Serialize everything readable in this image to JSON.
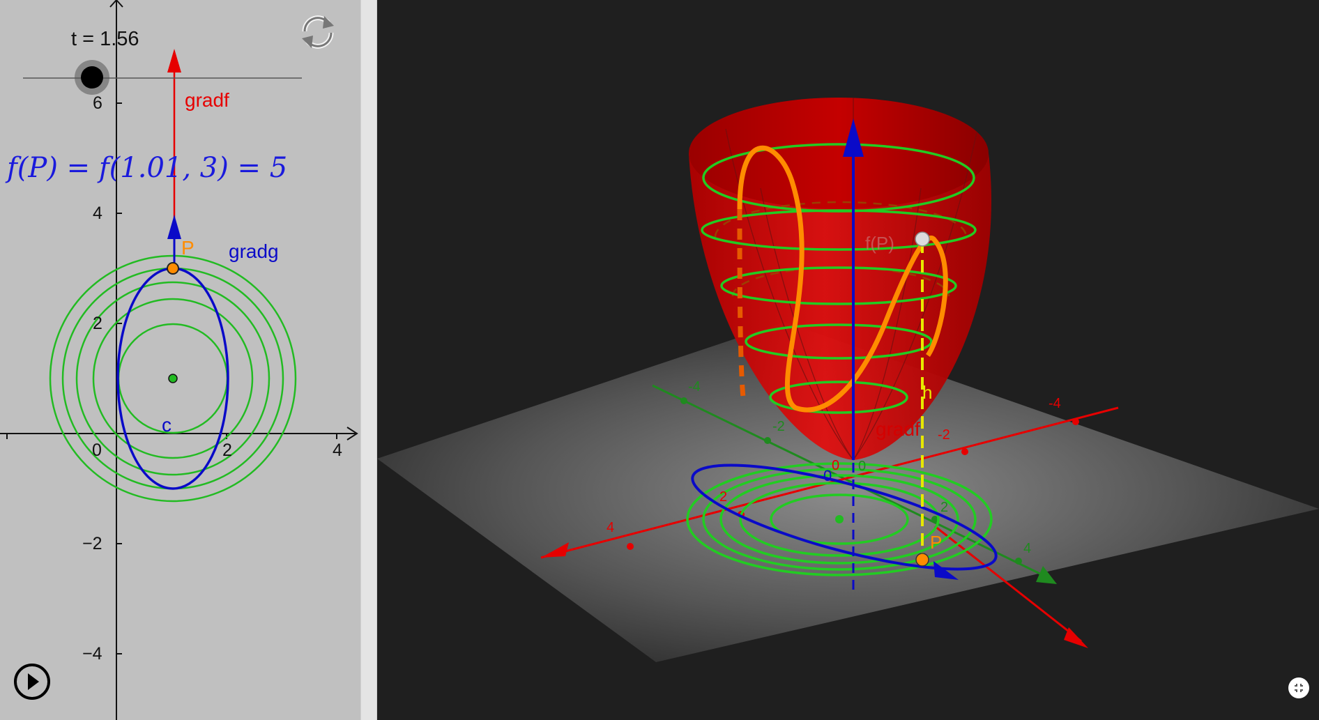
{
  "left_view": {
    "slider_label": "t = 1.56",
    "formula": "f(P) = f(1.01, 3) = 5",
    "x_tick_labels": [
      "0",
      "2",
      "4"
    ],
    "y_tick_labels": [
      "6",
      "4",
      "2",
      "−2",
      "−4"
    ],
    "labels": {
      "gradf": "gradf",
      "gradg": "gradg",
      "point_p": "P",
      "curve_c": "c"
    }
  },
  "right_view": {
    "labels": {
      "fp": "f(P)",
      "h": "h",
      "gradf": "gradf",
      "point_p": "P"
    },
    "x_axis_ticks": [
      "-4",
      "-2",
      "0",
      "2",
      "4"
    ],
    "y_axis_ticks": [
      "-4",
      "-2",
      "0",
      "2",
      "4"
    ],
    "z_axis_ticks": [
      "0"
    ]
  },
  "colors": {
    "gradf": "#e60000",
    "gradg": "#0000cc",
    "level_curves": "#22bb22",
    "curve": "#ff8c00",
    "surface": "#c00000",
    "helper_line": "#e8e800"
  },
  "icons": {
    "reset": "reset-icon",
    "play": "play-icon",
    "fullscreen": "exit-fullscreen-icon"
  }
}
